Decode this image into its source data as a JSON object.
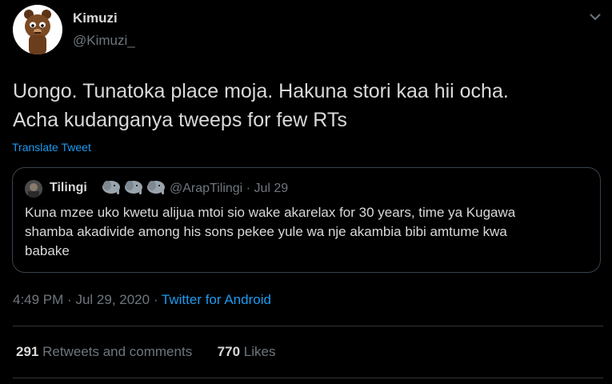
{
  "author": {
    "name": "Kimuzi",
    "handle": "@Kimuzi_"
  },
  "tweet": {
    "lines": [
      "Uongo. Tunatoka place moja. Hakuna stori kaa hii ocha.",
      "Acha kudanganya tweeps for few RTs"
    ],
    "translate_label": "Translate Tweet"
  },
  "quoted": {
    "name": "Tilingi",
    "emoji_icons": [
      "elephant-emoji",
      "elephant-emoji",
      "elephant-emoji"
    ],
    "handle": "@ArapTilingi",
    "separator": "·",
    "date": "Jul 29",
    "lines": [
      "Kuna mzee uko kwetu alijua mtoi sio wake akarelax for 30 years, time ya Kugawa",
      "shamba akadivide among his sons pekee yule wa nje  akambia bibi amtume kwa",
      "babake"
    ]
  },
  "meta": {
    "time": "4:49 PM",
    "sep": "·",
    "date": "Jul 29, 2020",
    "source": "Twitter for Android"
  },
  "stats": {
    "retweets_count": "291",
    "retweets_label": "Retweets and comments",
    "likes_count": "770",
    "likes_label": "Likes"
  },
  "colors": {
    "background": "#000000",
    "text": "#d9d9d9",
    "muted": "#6e767d",
    "link": "#1d9bf0",
    "border": "#38444d"
  }
}
